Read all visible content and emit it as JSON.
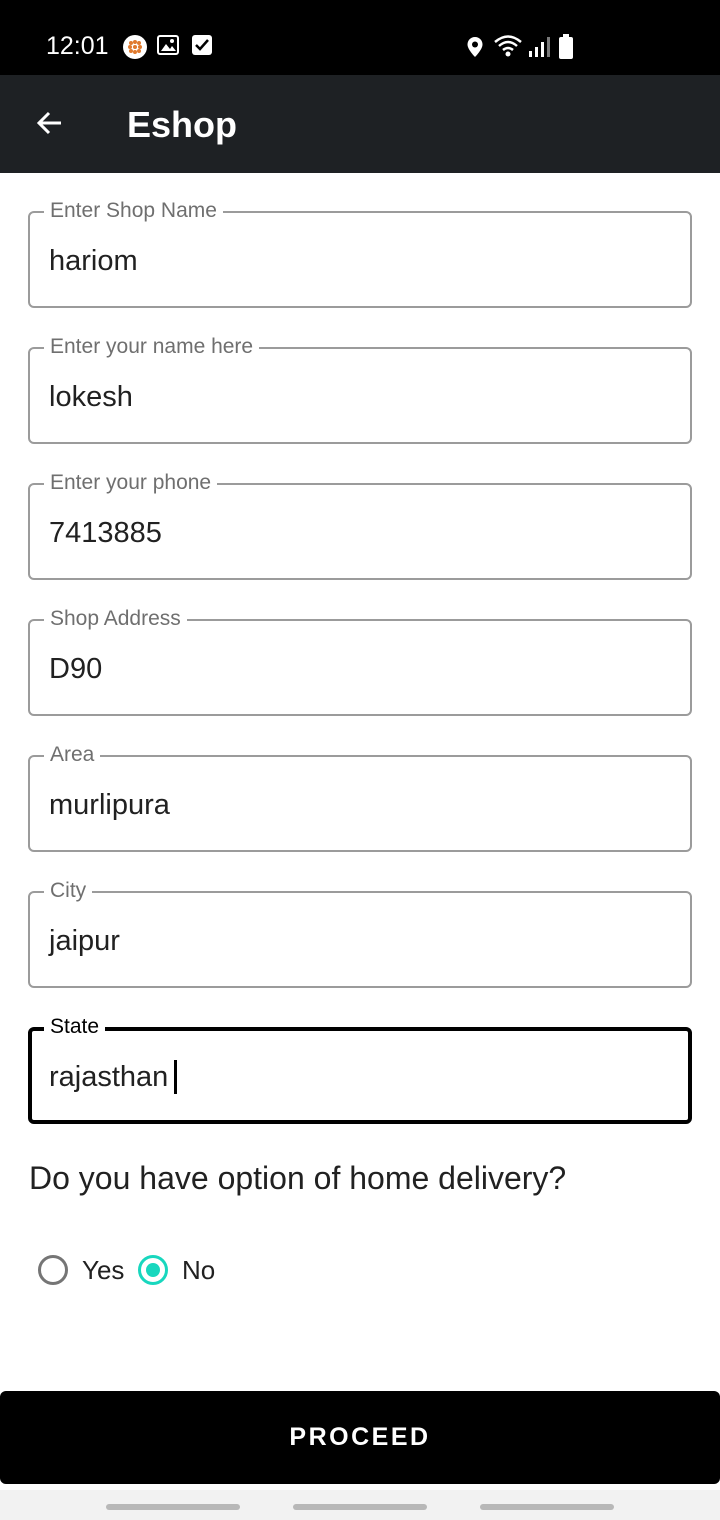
{
  "status_bar": {
    "time": "12:01",
    "icons_left": [
      "notification-app-icon",
      "gallery-icon",
      "checkbox-icon"
    ],
    "icons_right": [
      "location-icon",
      "wifi-icon",
      "signal-icon",
      "battery-icon"
    ]
  },
  "app_bar": {
    "title": "Eshop",
    "back_icon": "arrow-left-icon"
  },
  "form": {
    "fields": [
      {
        "label": "Enter Shop Name",
        "value": "hariom"
      },
      {
        "label": "Enter your name here",
        "value": "lokesh"
      },
      {
        "label": "Enter your phone",
        "value": "7413885"
      },
      {
        "label": "Shop Address",
        "value": "D90"
      },
      {
        "label": "Area",
        "value": "murlipura"
      },
      {
        "label": "City",
        "value": "jaipur"
      },
      {
        "label": "State",
        "value": "rajasthan"
      }
    ],
    "focused_field": "State"
  },
  "delivery": {
    "question": "Do you have option of home delivery?",
    "options": [
      {
        "label": "Yes",
        "checked": false
      },
      {
        "label": "No",
        "checked": true
      }
    ]
  },
  "proceed_label": "PROCEED",
  "colors": {
    "accent": "#18d7be",
    "app_bar": "#1e2124",
    "button": "#000000"
  }
}
